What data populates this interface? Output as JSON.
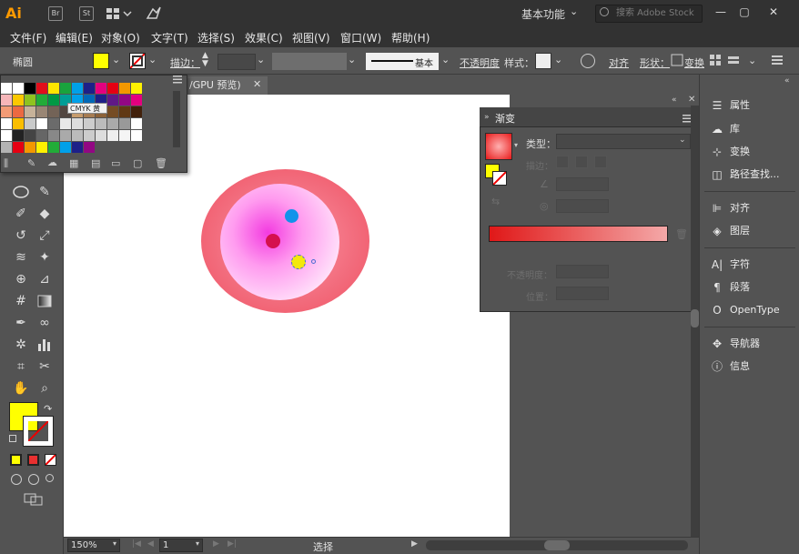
{
  "app": {
    "logo": "Ai"
  },
  "titlebar": {
    "workspace": "基本功能",
    "search_placeholder": "搜索 Adobe Stock"
  },
  "menu": [
    "文件(F)",
    "编辑(E)",
    "对象(O)",
    "文字(T)",
    "选择(S)",
    "效果(C)",
    "视图(V)",
    "窗口(W)",
    "帮助(H)"
  ],
  "control": {
    "selection_type": "椭圆",
    "stroke_label": "描边：",
    "stroke_style": "基本",
    "opacity_label": "不透明度",
    "style_label": "样式：",
    "align_label": "对齐",
    "shape_label": "形状：",
    "transform_label": "变换",
    "fill_color": "#ffff00"
  },
  "document": {
    "tab_title": "/GPU 预览)"
  },
  "swatches": {
    "tooltip": "CMYK 黄"
  },
  "gradient_panel": {
    "title": "渐变",
    "type_label": "类型：",
    "stroke_label": "描边：",
    "opacity_label": "不透明度：",
    "position_label": "位置："
  },
  "dock": {
    "items": [
      "属性",
      "库",
      "变换",
      "路径查找...",
      "对齐",
      "图层",
      "字符",
      "段落",
      "OpenType",
      "导航器",
      "信息"
    ]
  },
  "status": {
    "zoom": "150%",
    "page": "1",
    "tool": "选择"
  },
  "colors": {
    "fill": "#ffff00",
    "gradient_start": "#e01818",
    "gradient_end": "#f4a8a8"
  }
}
